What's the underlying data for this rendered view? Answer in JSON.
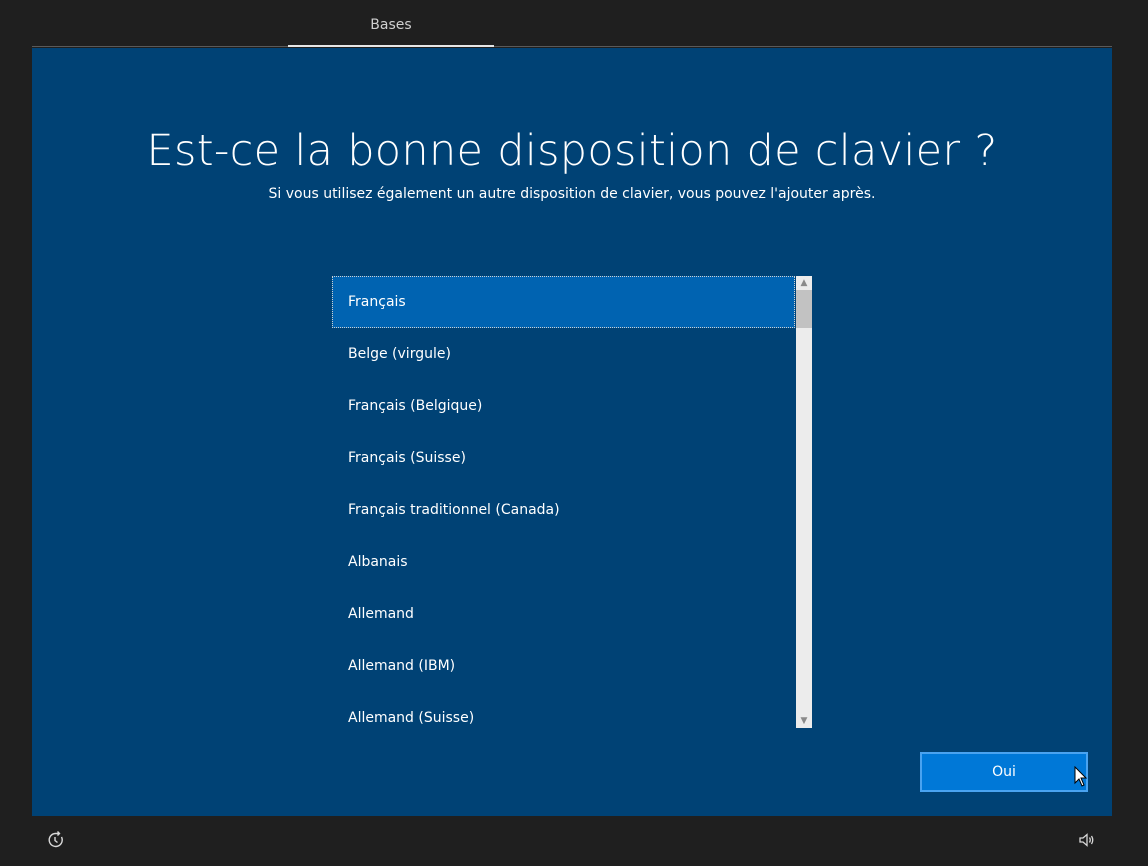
{
  "header": {
    "tab_label": "Bases"
  },
  "main": {
    "title": "Est-ce la bonne disposition de clavier ?",
    "subtitle": "Si vous utilisez également un autre disposition de clavier, vous pouvez l'ajouter après."
  },
  "keyboard_list": {
    "items": [
      {
        "label": "Français",
        "selected": true
      },
      {
        "label": "Belge (virgule)",
        "selected": false
      },
      {
        "label": "Français (Belgique)",
        "selected": false
      },
      {
        "label": "Français (Suisse)",
        "selected": false
      },
      {
        "label": "Français traditionnel (Canada)",
        "selected": false
      },
      {
        "label": "Albanais",
        "selected": false
      },
      {
        "label": "Allemand",
        "selected": false
      },
      {
        "label": "Allemand (IBM)",
        "selected": false
      },
      {
        "label": "Allemand (Suisse)",
        "selected": false
      }
    ]
  },
  "footer": {
    "confirm_label": "Oui",
    "left_icon": "accessibility-icon",
    "right_icon": "volume-icon"
  },
  "colors": {
    "panel_bg": "#004275",
    "selected_bg": "#0063b1",
    "button_bg": "#0078d7",
    "outer_bg": "#1f1f1f"
  }
}
